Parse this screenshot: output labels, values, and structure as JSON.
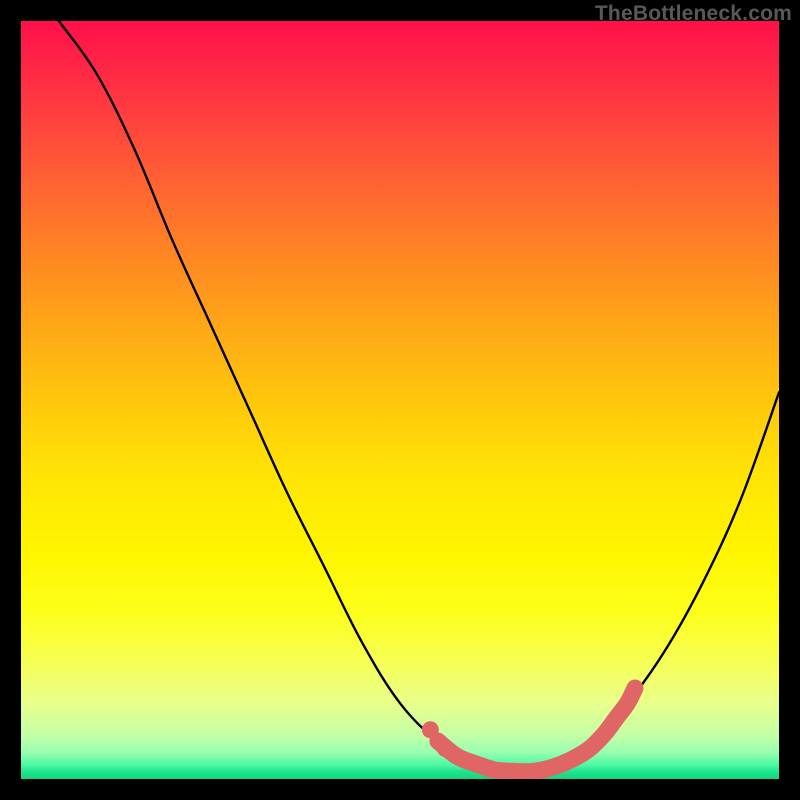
{
  "watermark": "TheBottleneck.com",
  "chart_data": {
    "type": "line",
    "title": "",
    "xlabel": "",
    "ylabel": "",
    "xlim": [
      0,
      100
    ],
    "ylim": [
      0,
      100
    ],
    "series": [
      {
        "name": "bottleneck-curve",
        "x": [
          5,
          10,
          15,
          20,
          25,
          30,
          35,
          40,
          45,
          50,
          55,
          60,
          63,
          66,
          70,
          75,
          80,
          85,
          90,
          95,
          100
        ],
        "y": [
          100,
          93,
          83,
          71,
          60,
          49,
          38,
          28,
          18,
          10,
          5,
          2,
          1,
          1,
          2,
          5,
          10,
          17,
          26,
          37,
          51
        ]
      }
    ],
    "highlight": {
      "name": "optimal-range",
      "x": [
        55,
        57.5,
        60,
        62.5,
        65,
        67.5,
        70,
        72.5,
        75,
        77,
        78.5,
        80,
        81
      ],
      "y": [
        5,
        3,
        2,
        1.2,
        1,
        1,
        1.5,
        2.5,
        4,
        6,
        8,
        10,
        12
      ]
    }
  }
}
